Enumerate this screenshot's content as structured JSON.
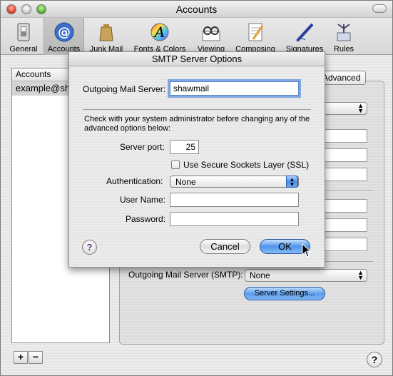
{
  "window": {
    "title": "Accounts"
  },
  "toolbar": {
    "items": [
      {
        "label": "General",
        "icon": "switch-icon"
      },
      {
        "label": "Accounts",
        "icon": "at-sign-icon"
      },
      {
        "label": "Junk Mail",
        "icon": "trash-bag-icon"
      },
      {
        "label": "Fonts & Colors",
        "icon": "font-color-icon"
      },
      {
        "label": "Viewing",
        "icon": "glasses-icon"
      },
      {
        "label": "Composing",
        "icon": "notepad-pencil-icon"
      },
      {
        "label": "Signatures",
        "icon": "pen-icon"
      },
      {
        "label": "Rules",
        "icon": "rules-icon"
      }
    ],
    "selected": "Accounts"
  },
  "accounts": {
    "header": "Accounts",
    "items": [
      "example@sh"
    ],
    "add_label": "+",
    "remove_label": "−"
  },
  "background_panel": {
    "tab_advanced": "Advanced",
    "smtp_label": "Outgoing Mail Server (SMTP):",
    "smtp_value": "None",
    "server_settings_button": "Server Settings..."
  },
  "sheet": {
    "title": "SMTP Server Options",
    "outgoing_label": "Outgoing Mail Server:",
    "outgoing_value": "shawmail",
    "note": "Check with your system administrator before changing any of the advanced options below:",
    "port_label": "Server port:",
    "port_value": "25",
    "ssl_label": "Use Secure Sockets Layer (SSL)",
    "ssl_checked": false,
    "auth_label": "Authentication:",
    "auth_value": "None",
    "username_label": "User Name:",
    "username_value": "",
    "password_label": "Password:",
    "password_value": "",
    "cancel_label": "Cancel",
    "ok_label": "OK",
    "help_label": "?"
  },
  "help_label": "?"
}
